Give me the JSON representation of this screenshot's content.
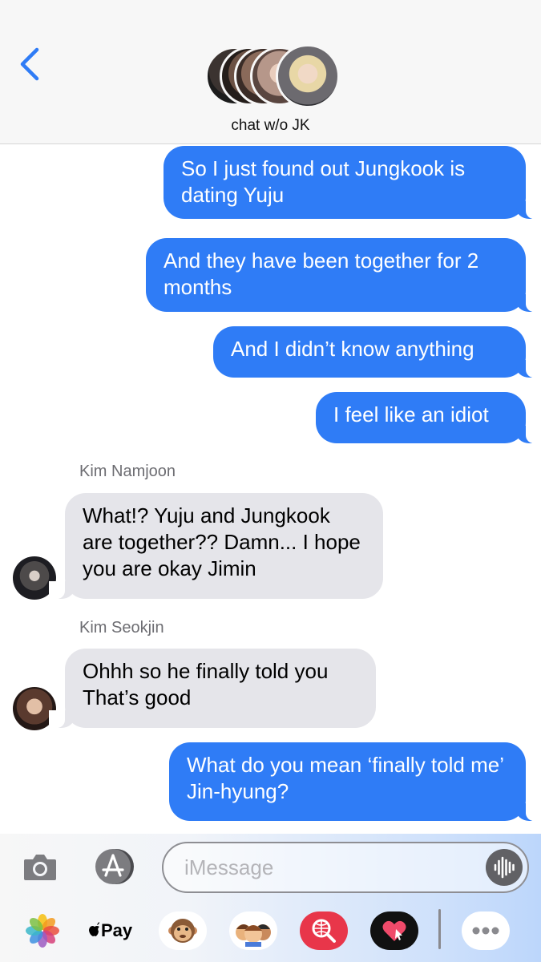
{
  "header": {
    "group_name": "chat w/o JK"
  },
  "messages": [
    {
      "type": "out",
      "text": "So I just found out Jungkook is dating Yuju"
    },
    {
      "type": "out",
      "text": "And they have been together for 2 months"
    },
    {
      "type": "out",
      "text": "And I didn’t know anything"
    },
    {
      "type": "out",
      "text": "I feel like an idiot"
    },
    {
      "type": "in",
      "sender": "Kim Namjoon",
      "text": "What!? Yuju and Jungkook are together?? Damn... I hope you are okay Jimin"
    },
    {
      "type": "in",
      "sender": "Kim Seokjin",
      "text": "Ohhh so he finally told you That’s good"
    },
    {
      "type": "out",
      "text": "What do you mean ‘finally told me’ Jin-hyung?"
    }
  ],
  "composer": {
    "placeholder": "iMessage",
    "value": ""
  },
  "app_tray": {
    "apple_pay_label": "Pay",
    "icons": [
      "photos-icon",
      "apple-pay-icon",
      "animoji-icon",
      "memoji-icon",
      "web-search-icon",
      "digital-touch-icon",
      "more-icon"
    ]
  },
  "colors": {
    "outgoing_bubble": "#2f7cf6",
    "incoming_bubble": "#e5e5ea",
    "accent": "#2f7cf6"
  }
}
